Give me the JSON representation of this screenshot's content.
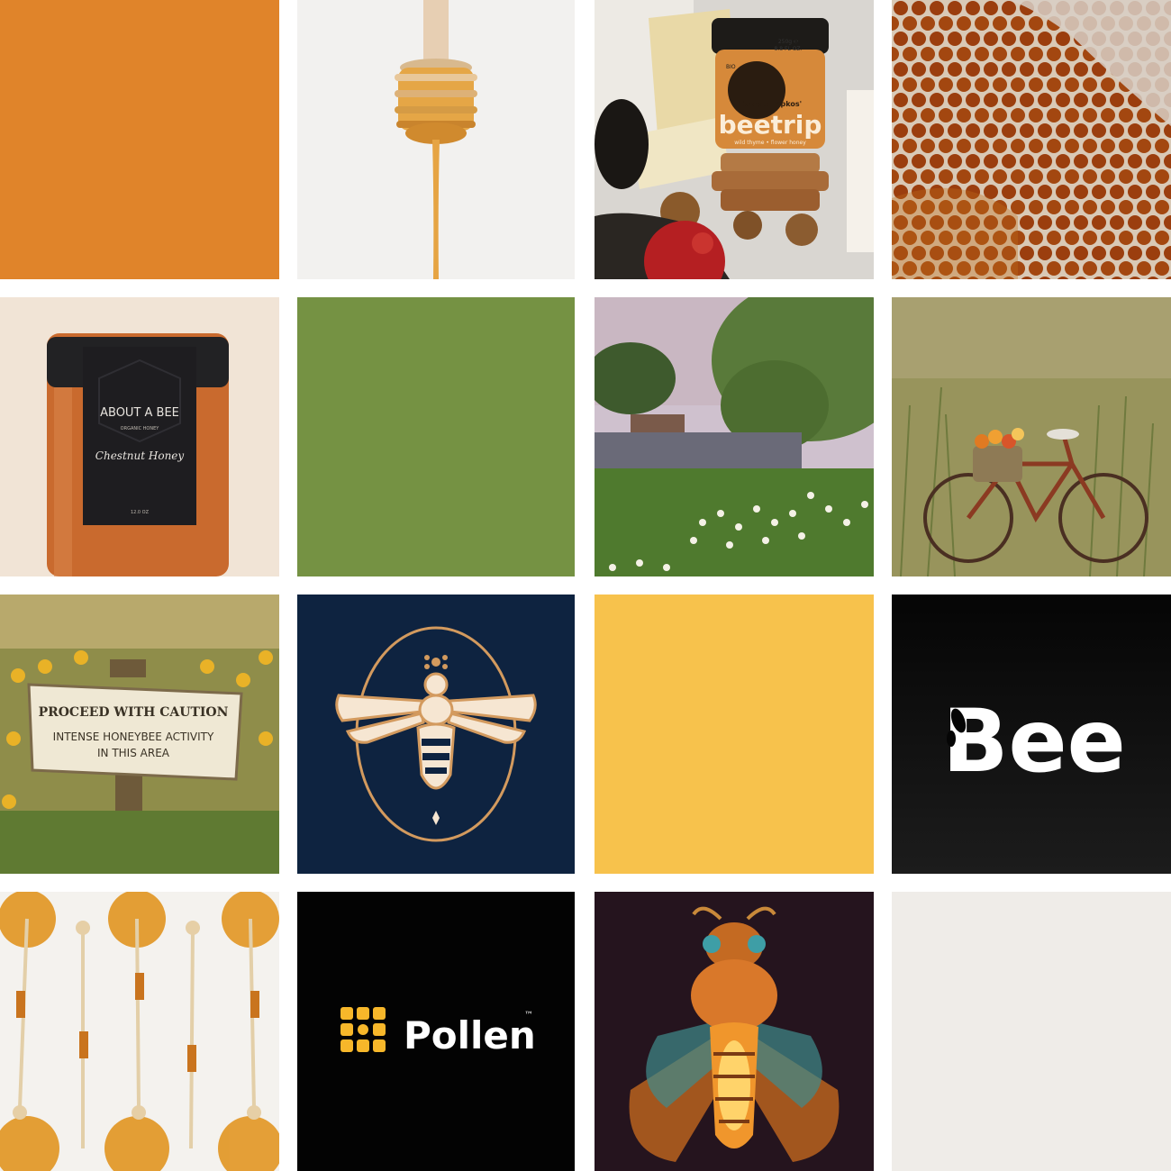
{
  "swatches": {
    "orange": "#E0842A",
    "green": "#759243",
    "yellow": "#F7C24C",
    "offwhite": "#EFECE8"
  },
  "jar_beetrip": {
    "brand": "beetrip",
    "maker": "George Tripkos'",
    "weight": "250g ℮",
    "floz": "8.8 FL OZ.",
    "bio": "BIO",
    "subtitle": "wild thyme • flower honey"
  },
  "jar_about": {
    "brand": "ABOUT A BEE",
    "sub": "ORGANIC HONEY",
    "variety": "Chestnut Honey",
    "size": "12.0 OZ"
  },
  "sign": {
    "line1": "PROCEED WITH CAUTION",
    "line2": "INTENSE HONEYBEE ACTIVITY",
    "line3": "IN THIS AREA"
  },
  "logo_bee": {
    "text": "Bee"
  },
  "logo_pollen": {
    "text": "Pollen",
    "tm": "™"
  }
}
